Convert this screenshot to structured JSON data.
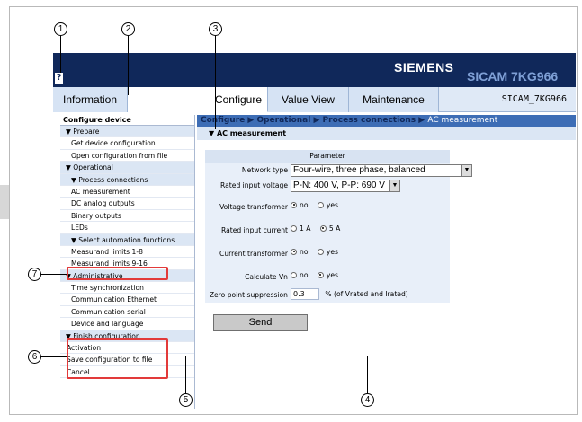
{
  "header": {
    "help_icon": "?",
    "brand": "SIEMENS",
    "product": "SICAM 7KG966",
    "colors": {
      "header_bg": "#10285a",
      "accent": "#3d6db5",
      "highlight": "#e23a3a"
    }
  },
  "tabs": [
    {
      "label": "Information"
    },
    {
      "label": "Configure"
    },
    {
      "label": "Value View"
    },
    {
      "label": "Maintenance"
    }
  ],
  "device_name": "SICAM_7KG966",
  "sidebar": {
    "title": "Configure device",
    "rows": [
      {
        "label": "▼ Prepare"
      },
      {
        "label": "Get device configuration"
      },
      {
        "label": "Open configuration from file"
      },
      {
        "label": "▼ Operational"
      },
      {
        "label": "▼ Process connections"
      },
      {
        "label": "AC measurement"
      },
      {
        "label": "DC analog outputs"
      },
      {
        "label": "Binary outputs"
      },
      {
        "label": "LEDs"
      },
      {
        "label": "▼ Select automation functions"
      },
      {
        "label": "Measurand limits 1-8"
      },
      {
        "label": "Measurand limits 9-16"
      },
      {
        "label": "▼ Administrative"
      },
      {
        "label": "Time synchronization"
      },
      {
        "label": "Communication Ethernet"
      },
      {
        "label": "Communication serial"
      },
      {
        "label": "Device and language"
      },
      {
        "label": "▼ Finish configuration"
      },
      {
        "label": "Activation"
      },
      {
        "label": "Save configuration to file"
      },
      {
        "label": "Cancel"
      }
    ]
  },
  "breadcrumb": {
    "items": [
      "Configure",
      "Operational",
      "Process connections"
    ],
    "current": "AC measurement",
    "separator": "▶"
  },
  "section": {
    "title": "▼ AC measurement"
  },
  "parameters": {
    "header": "Parameter",
    "network_type": {
      "label": "Network type",
      "value": "Four-wire, three phase, balanced"
    },
    "rated_input_voltage": {
      "label": "Rated input voltage",
      "value": "P-N: 400 V, P-P: 690 V"
    },
    "voltage_transformer": {
      "label": "Voltage transformer",
      "options": [
        "no",
        "yes"
      ],
      "selected": "no"
    },
    "rated_input_current": {
      "label": "Rated input current",
      "options": [
        "1 A",
        "5 A"
      ],
      "selected": "5 A"
    },
    "current_transformer": {
      "label": "Current transformer",
      "options": [
        "no",
        "yes"
      ],
      "selected": "no"
    },
    "calculate_vn": {
      "label": "Calculate Vn",
      "options": [
        "no",
        "yes"
      ],
      "selected": "yes"
    },
    "zero_point_suppression": {
      "label": "Zero point suppression",
      "value": "0.3",
      "unit": "% (of Vrated and Irated)"
    }
  },
  "send_button": "Send",
  "callouts": [
    "1",
    "2",
    "3",
    "4",
    "5",
    "6",
    "7"
  ]
}
